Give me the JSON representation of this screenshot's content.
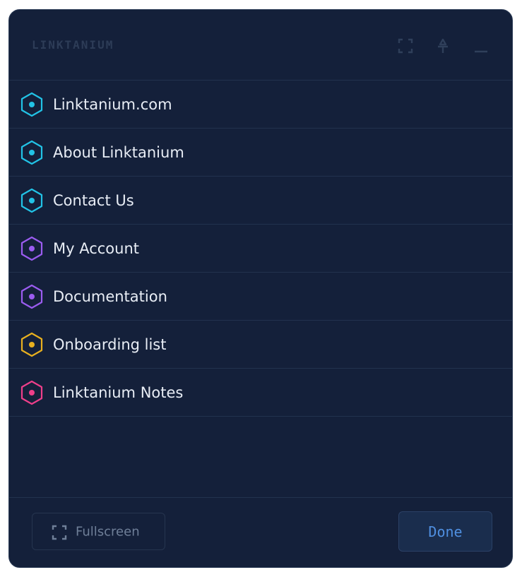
{
  "header": {
    "title": "LINKTANIUM",
    "buttons": [
      {
        "icon": "expand-icon"
      },
      {
        "icon": "pin-icon"
      },
      {
        "icon": "minimize-icon"
      }
    ]
  },
  "links": [
    {
      "label": "Linktanium.com",
      "color": "#22c3e6",
      "icon": "hexagon-icon"
    },
    {
      "label": "About Linktanium",
      "color": "#22c3e6",
      "icon": "hexagon-icon"
    },
    {
      "label": "Contact Us",
      "color": "#22c3e6",
      "icon": "hexagon-icon"
    },
    {
      "label": "My Account",
      "color": "#9b5cf0",
      "icon": "hexagon-icon"
    },
    {
      "label": "Documentation",
      "color": "#9b5cf0",
      "icon": "hexagon-icon"
    },
    {
      "label": "Onboarding list",
      "color": "#e8b01f",
      "icon": "hexagon-icon"
    },
    {
      "label": "Linktanium Notes",
      "color": "#ee3f8a",
      "icon": "hexagon-icon"
    }
  ],
  "footer": {
    "fullscreen_label": "Fullscreen",
    "done_label": "Done"
  },
  "colors": {
    "background": "#14203a",
    "accent": "#4f8fe0"
  }
}
